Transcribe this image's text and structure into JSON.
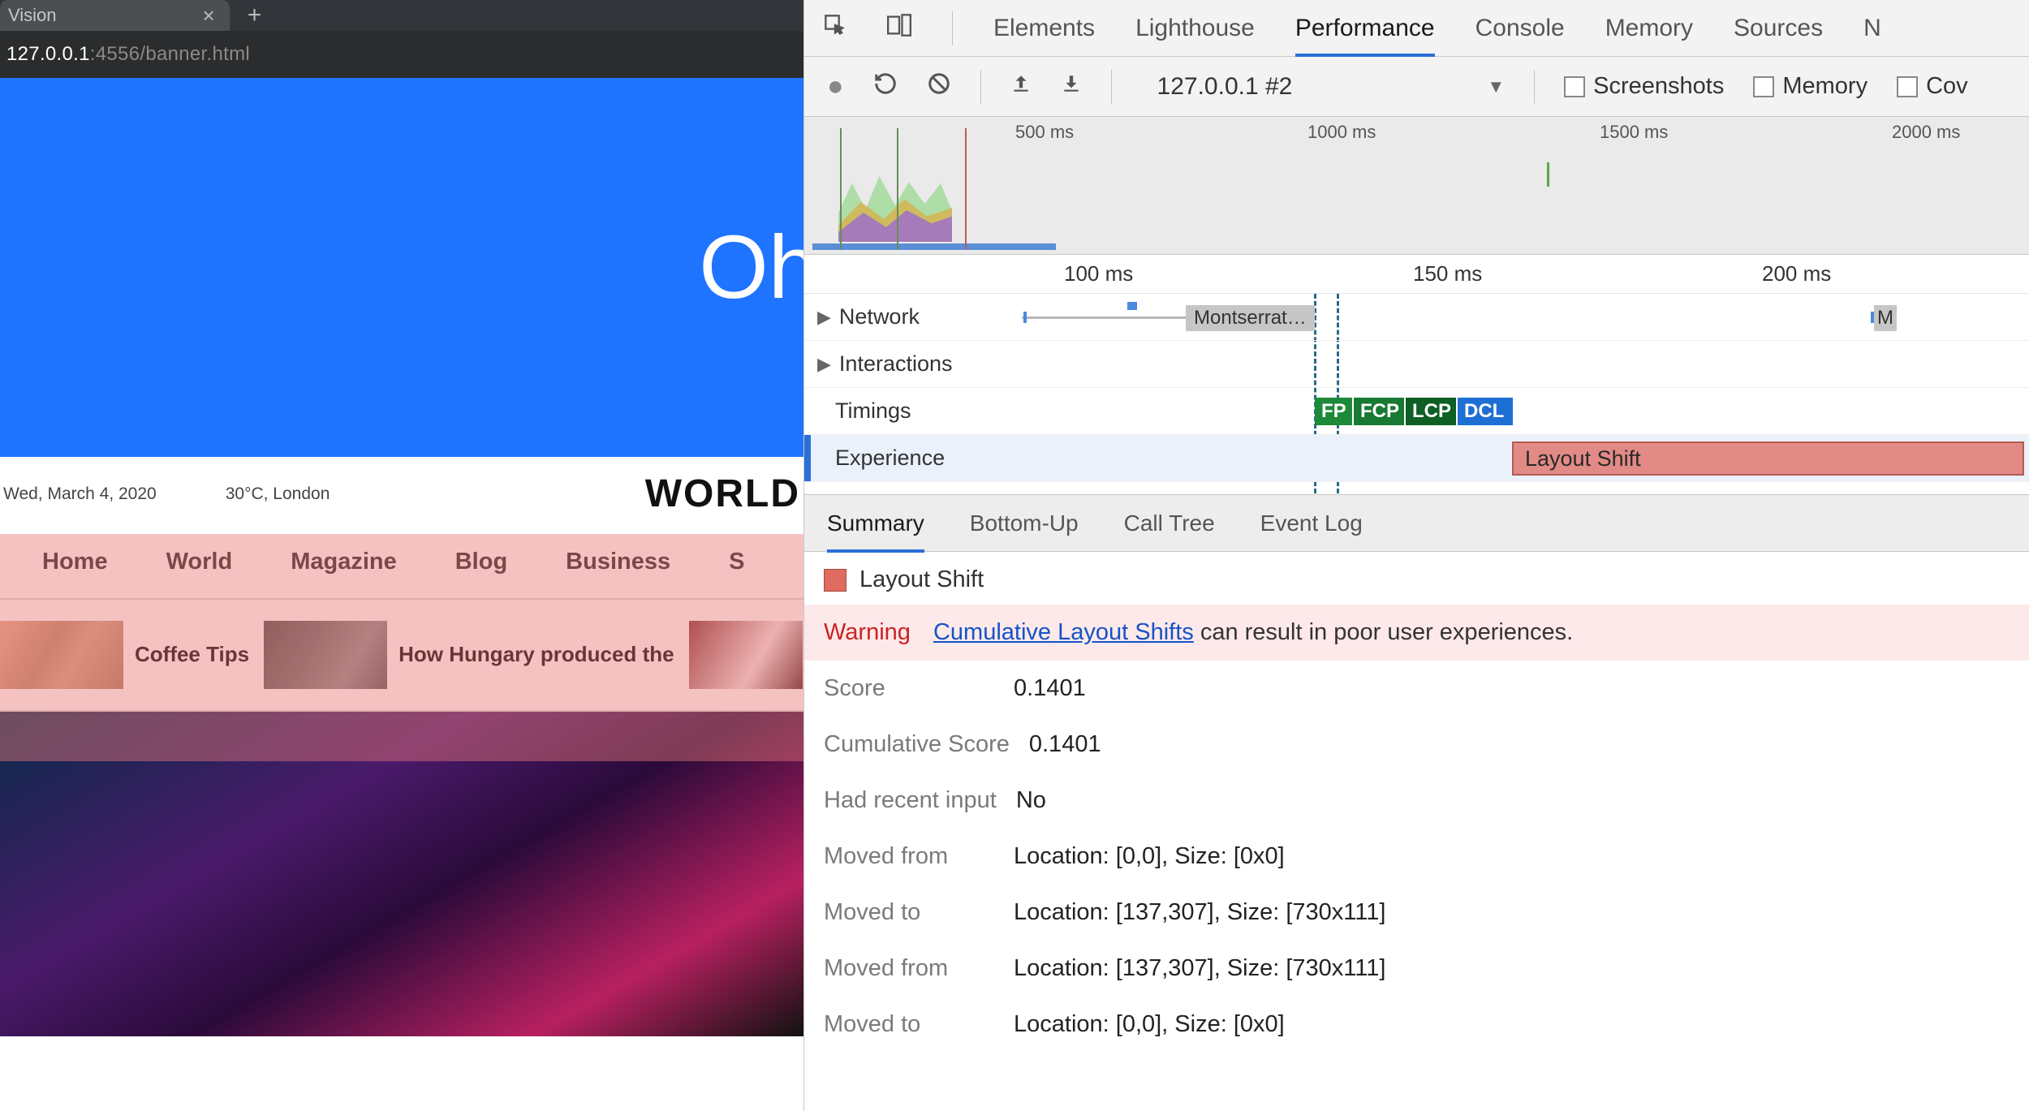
{
  "browser": {
    "tab_title": "Vision",
    "url_host": "127.0.0.1",
    "url_path": ":4556/banner.html",
    "banner_text": "Oh",
    "date": "Wed, March 4, 2020",
    "weather": "30°C, London",
    "site_title": "WORLD",
    "nav": [
      "Home",
      "World",
      "Magazine",
      "Blog",
      "Business",
      "S"
    ],
    "teasers": [
      {
        "title": "Coffee Tips"
      },
      {
        "title": "How Hungary produced the"
      }
    ]
  },
  "devtools": {
    "tabs": [
      "Elements",
      "Lighthouse",
      "Performance",
      "Console",
      "Memory",
      "Sources",
      "N"
    ],
    "active_tab": "Performance",
    "toolbar": {
      "recording_label": "127.0.0.1 #2",
      "checkboxes": [
        "Screenshots",
        "Memory",
        "Cov"
      ]
    },
    "overview_ticks": [
      "500 ms",
      "1000 ms",
      "1500 ms",
      "2000 ms"
    ],
    "flame_ruler": [
      "100 ms",
      "150 ms",
      "200 ms"
    ],
    "lanes": {
      "network": "Network",
      "interactions": "Interactions",
      "timings": "Timings",
      "experience": "Experience"
    },
    "network_chip": "Montserrat…",
    "network_chip2": "M",
    "timing_chips": {
      "fp": "FP",
      "fcp": "FCP",
      "lcp": "LCP",
      "dcl": "DCL"
    },
    "experience_chip": "Layout Shift",
    "subtabs": [
      "Summary",
      "Bottom-Up",
      "Call Tree",
      "Event Log"
    ],
    "active_subtab": "Summary",
    "summary": {
      "title": "Layout Shift",
      "warning_label": "Warning",
      "warning_link": "Cumulative Layout Shifts",
      "warning_rest": " can result in poor user experiences.",
      "rows": [
        {
          "k": "Score",
          "v": "0.1401"
        },
        {
          "k": "Cumulative Score",
          "v": "0.1401"
        },
        {
          "k": "Had recent input",
          "v": "No"
        },
        {
          "k": "Moved from",
          "v": "Location: [0,0], Size: [0x0]"
        },
        {
          "k": "Moved to",
          "v": "Location: [137,307], Size: [730x111]"
        },
        {
          "k": "Moved from",
          "v": "Location: [137,307], Size: [730x111]"
        },
        {
          "k": "Moved to",
          "v": "Location: [0,0], Size: [0x0]"
        }
      ]
    }
  }
}
